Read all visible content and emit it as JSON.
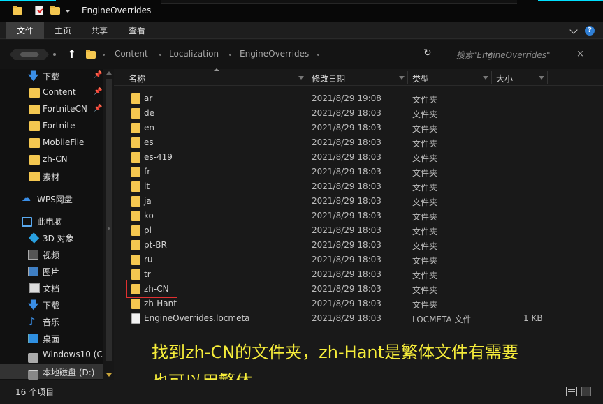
{
  "window": {
    "title": "EngineOverrides"
  },
  "ribbon": {
    "tabs": [
      {
        "label": "文件",
        "active": true
      },
      {
        "label": "主页",
        "active": false
      },
      {
        "label": "共享",
        "active": false
      },
      {
        "label": "查看",
        "active": false
      }
    ],
    "help_label": "?"
  },
  "address": {
    "crumbs": [
      "Content",
      "Localization",
      "EngineOverrides"
    ],
    "up_arrow": "↑",
    "refresh_glyph": "↻"
  },
  "search": {
    "placeholder": "搜索\"EngineOverrides\"",
    "clear": "×"
  },
  "nav": {
    "quick_access": [
      {
        "label": "下载",
        "icon": "download-arrow-icon",
        "pinned": true
      },
      {
        "label": "Content",
        "icon": "folder-icon",
        "pinned": true
      },
      {
        "label": "FortniteCN",
        "icon": "folder-icon",
        "pinned": true
      },
      {
        "label": "Fortnite",
        "icon": "folder-icon",
        "pinned": false
      },
      {
        "label": "MobileFile",
        "icon": "folder-icon",
        "pinned": false
      },
      {
        "label": "zh-CN",
        "icon": "folder-icon",
        "pinned": false
      },
      {
        "label": "素材",
        "icon": "folder-icon",
        "pinned": false
      }
    ],
    "wps": {
      "label": "WPS网盘",
      "icon": "cloud-icon"
    },
    "this_pc": {
      "label": "此电脑",
      "icon": "computer-icon"
    },
    "pc_items": [
      {
        "label": "3D 对象",
        "icon": "cube-3d-icon"
      },
      {
        "label": "视频",
        "icon": "video-icon"
      },
      {
        "label": "图片",
        "icon": "picture-icon"
      },
      {
        "label": "文档",
        "icon": "document-icon"
      },
      {
        "label": "下载",
        "icon": "download-arrow-icon"
      },
      {
        "label": "音乐",
        "icon": "music-note-icon"
      },
      {
        "label": "桌面",
        "icon": "desktop-icon"
      },
      {
        "label": "Windows10 (C:",
        "icon": "drive-icon"
      },
      {
        "label": "本地磁盘 (D:)",
        "icon": "drive-icon"
      }
    ],
    "pin_glyph": "📌"
  },
  "columns": {
    "name": "名称",
    "modified": "修改日期",
    "type": "类型",
    "size": "大小"
  },
  "files": [
    {
      "name": "ar",
      "modified": "2021/8/29 19:08",
      "type": "文件夹",
      "size": "",
      "kind": "folder"
    },
    {
      "name": "de",
      "modified": "2021/8/29 18:03",
      "type": "文件夹",
      "size": "",
      "kind": "folder"
    },
    {
      "name": "en",
      "modified": "2021/8/29 18:03",
      "type": "文件夹",
      "size": "",
      "kind": "folder"
    },
    {
      "name": "es",
      "modified": "2021/8/29 18:03",
      "type": "文件夹",
      "size": "",
      "kind": "folder"
    },
    {
      "name": "es-419",
      "modified": "2021/8/29 18:03",
      "type": "文件夹",
      "size": "",
      "kind": "folder"
    },
    {
      "name": "fr",
      "modified": "2021/8/29 18:03",
      "type": "文件夹",
      "size": "",
      "kind": "folder"
    },
    {
      "name": "it",
      "modified": "2021/8/29 18:03",
      "type": "文件夹",
      "size": "",
      "kind": "folder"
    },
    {
      "name": "ja",
      "modified": "2021/8/29 18:03",
      "type": "文件夹",
      "size": "",
      "kind": "folder"
    },
    {
      "name": "ko",
      "modified": "2021/8/29 18:03",
      "type": "文件夹",
      "size": "",
      "kind": "folder"
    },
    {
      "name": "pl",
      "modified": "2021/8/29 18:03",
      "type": "文件夹",
      "size": "",
      "kind": "folder"
    },
    {
      "name": "pt-BR",
      "modified": "2021/8/29 18:03",
      "type": "文件夹",
      "size": "",
      "kind": "folder"
    },
    {
      "name": "ru",
      "modified": "2021/8/29 18:03",
      "type": "文件夹",
      "size": "",
      "kind": "folder"
    },
    {
      "name": "tr",
      "modified": "2021/8/29 18:03",
      "type": "文件夹",
      "size": "",
      "kind": "folder"
    },
    {
      "name": "zh-CN",
      "modified": "2021/8/29 18:03",
      "type": "文件夹",
      "size": "",
      "kind": "folder",
      "highlighted": true
    },
    {
      "name": "zh-Hant",
      "modified": "2021/8/29 18:03",
      "type": "文件夹",
      "size": "",
      "kind": "folder"
    },
    {
      "name": "EngineOverrides.locmeta",
      "modified": "2021/8/29 18:03",
      "type": "LOCMETA 文件",
      "size": "1 KB",
      "kind": "file"
    }
  ],
  "annotation": {
    "line1": "找到zh-CN的文件夹，zh-Hant是繁体文件有需要",
    "line2": "也可以用繁体",
    "color": "#f5ec3a",
    "highlight_color": "#e03030"
  },
  "status": {
    "count": "16 个项目"
  },
  "colors": {
    "accent_cyan": "#00e0ff",
    "folder_yellow": "#f4c750",
    "background": "#191919",
    "icon_blue": "#3a8ee6"
  }
}
